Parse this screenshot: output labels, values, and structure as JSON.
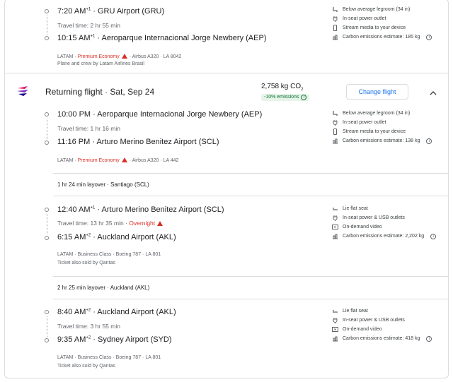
{
  "segments_top": {
    "dep_time": "7:20 AM",
    "dep_sup": "+1",
    "dep_airport": "GRU Airport (GRU)",
    "travel_time": "Travel time: 2 hr 55 min",
    "arr_time": "10:15 AM",
    "arr_sup": "+1",
    "arr_airport": "Aeroparque Internacional Jorge Newbery (AEP)",
    "airline": "LATAM",
    "cabin": "Premium Economy",
    "aircraft": "Airbus A320",
    "flight": "LA 8042",
    "note": "Plane and crew by Latam Airlines Brasil",
    "amenities": [
      "Below average legroom (34 in)",
      "In-seat power outlet",
      "Stream media to your device",
      "Carbon emissions estimate: 185 kg"
    ]
  },
  "returning": {
    "title": "Returning flight",
    "date": "Sat, Sep 24",
    "co2": "2,758 kg CO",
    "co2_sub": "2",
    "emissions_badge": "-10% emissions",
    "change_button": "Change flight"
  },
  "seg1": {
    "dep_time": "10:00 PM",
    "dep_airport": "Aeroparque Internacional Jorge Newbery (AEP)",
    "travel_time": "Travel time: 1 hr 16 min",
    "arr_time": "11:16 PM",
    "arr_airport": "Arturo Merino Benitez Airport (SCL)",
    "airline": "LATAM",
    "cabin": "Premium Economy",
    "aircraft": "Airbus A320",
    "flight": "LA 442",
    "amenities": [
      "Below average legroom (34 in)",
      "In-seat power outlet",
      "Stream media to your device",
      "Carbon emissions estimate: 138 kg"
    ]
  },
  "layover1": "1 hr 24 min layover · Santiago (SCL)",
  "seg2": {
    "dep_time": "12:40 AM",
    "dep_sup": "+1",
    "dep_airport": "Arturo Merino Benitez Airport (SCL)",
    "travel_time": "Travel time: 13 hr 35 min",
    "overnight": "Overnight",
    "arr_time": "6:15 AM",
    "arr_sup": "+2",
    "arr_airport": "Auckland Airport (AKL)",
    "airline": "LATAM",
    "cabin": "Business Class",
    "aircraft": "Boeing 787",
    "flight": "LA 801",
    "note": "Ticket also sold by Qantas",
    "amenities": [
      "Lie flat seat",
      "In-seat power & USB outlets",
      "On-demand video",
      "Carbon emissions estimate: 2,202 kg"
    ]
  },
  "layover2": "2 hr 25 min layover · Auckland (AKL)",
  "seg3": {
    "dep_time": "8:40 AM",
    "dep_sup": "+2",
    "dep_airport": "Auckland Airport (AKL)",
    "travel_time": "Travel time: 3 hr 55 min",
    "arr_time": "9:35 AM",
    "arr_sup": "+2",
    "arr_airport": "Sydney Airport (SYD)",
    "airline": "LATAM",
    "cabin": "Business Class",
    "aircraft": "Boeing 787",
    "flight": "LA 801",
    "note": "Ticket also sold by Qantas",
    "amenities": [
      "Lie flat seat",
      "In-seat power & USB outlets",
      "On-demand video",
      "Carbon emissions estimate: 418 kg"
    ]
  },
  "sep": "·",
  "colors": {
    "accent": "#1a73e8",
    "warning": "#d93025",
    "green": "#137333",
    "logo": "#7b2fbe"
  }
}
